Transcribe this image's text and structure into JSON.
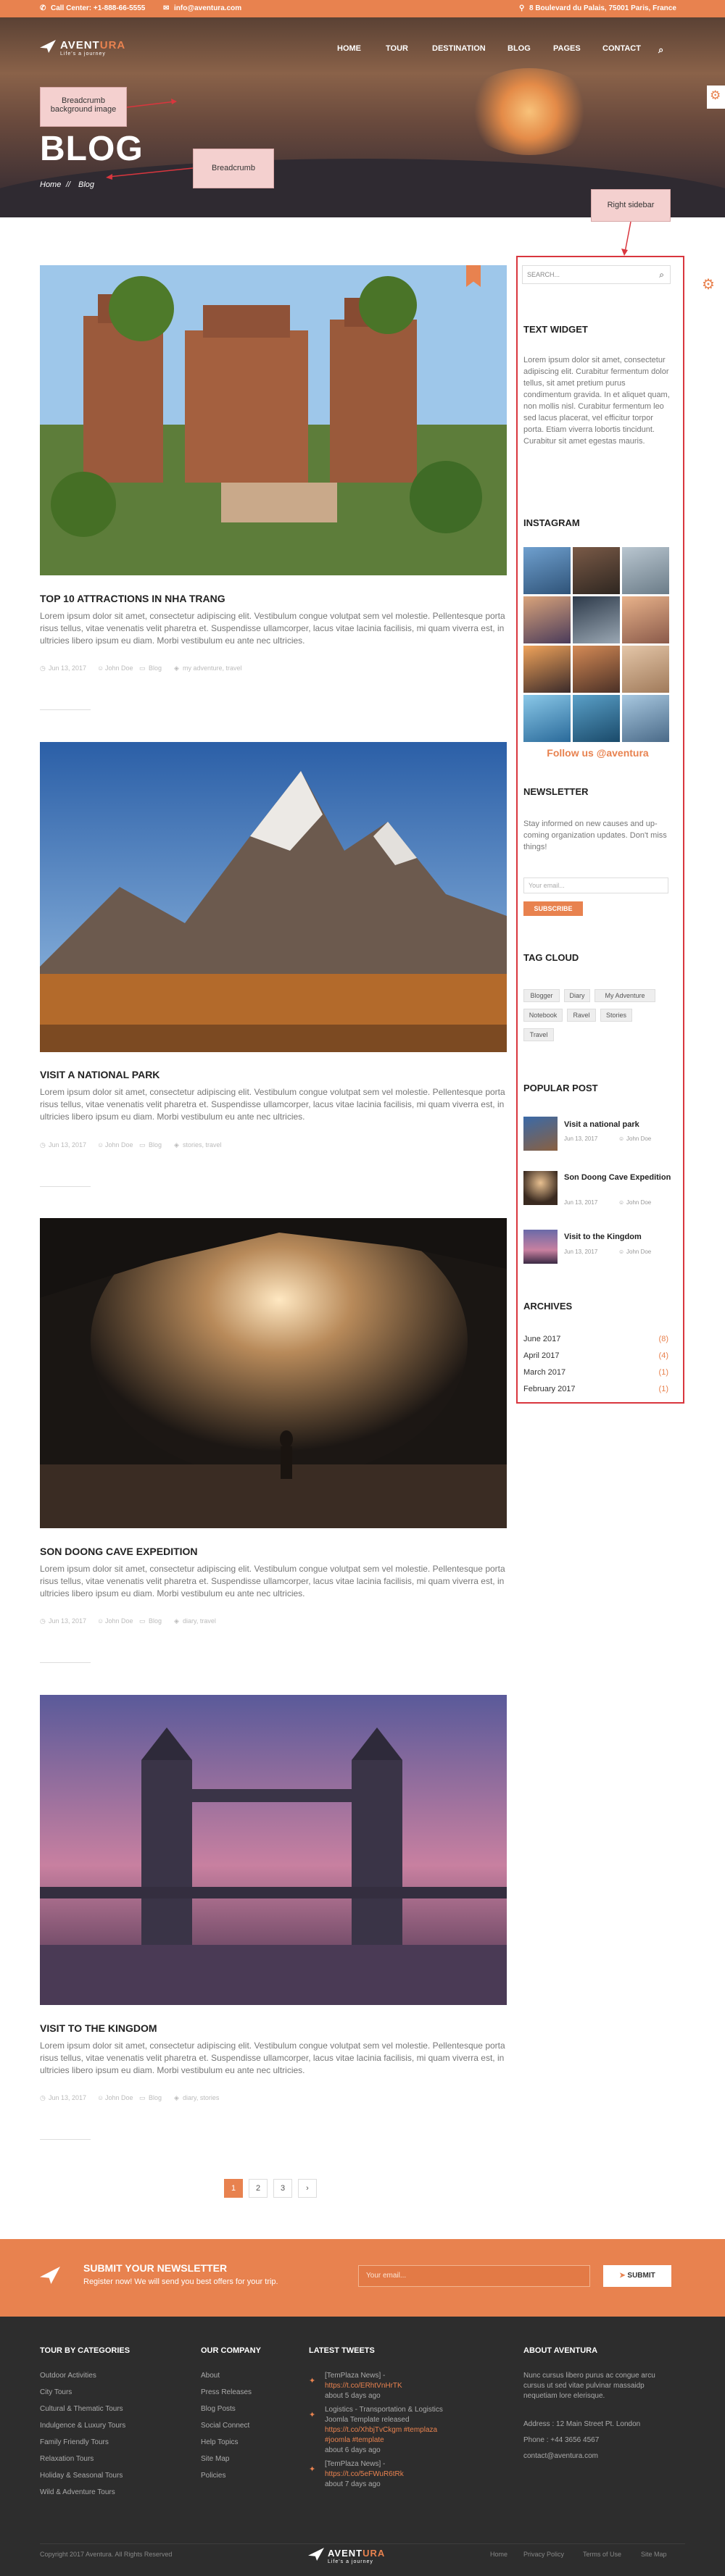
{
  "topbar": {
    "call": "Call Center: +1-888-66-5555",
    "email": "info@aventura.com",
    "address": "8 Boulevard du Palais, 75001 Paris, France"
  },
  "brand": {
    "name_main": "AVENT",
    "name_accent": "URA",
    "tagline": "Life's a journey"
  },
  "nav": {
    "items": [
      "HOME",
      "TOUR",
      "DESTINATION",
      "BLOG",
      "PAGES",
      "CONTACT"
    ]
  },
  "annotations": {
    "breadcrumb_bg": "Breadcrumb background image",
    "breadcrumb": "Breadcrumb",
    "sidebar": "Right sidebar"
  },
  "hero": {
    "title": "BLOG",
    "crumb_home": "Home",
    "crumb_sep": "//",
    "crumb_current": "Blog"
  },
  "posts": [
    {
      "title": "TOP 10 ATTRACTIONS IN NHA TRANG",
      "excerpt": "Lorem ipsum dolor sit amet, consectetur adipiscing elit. Vestibulum congue volutpat sem vel molestie. Pellentesque porta risus tellus, vitae venenatis velit pharetra et. Suspendisse ullamcorper, lacus vitae lacinia facilisis, mi quam viverra est, in ultricies libero ipsum eu diam. Morbi vestibulum eu ante nec ultricies.",
      "date": "Jun 13, 2017",
      "author": "John Doe",
      "category": "Blog",
      "tags": "my adventure, travel"
    },
    {
      "title": "VISIT A NATIONAL PARK",
      "excerpt": "Lorem ipsum dolor sit amet, consectetur adipiscing elit. Vestibulum congue volutpat sem vel molestie. Pellentesque porta risus tellus, vitae venenatis velit pharetra et. Suspendisse ullamcorper, lacus vitae lacinia facilisis, mi quam viverra est, in ultricies libero ipsum eu diam. Morbi vestibulum eu ante nec ultricies.",
      "date": "Jun 13, 2017",
      "author": "John Doe",
      "category": "Blog",
      "tags": "stories, travel"
    },
    {
      "title": "SON DOONG CAVE EXPEDITION",
      "excerpt": "Lorem ipsum dolor sit amet, consectetur adipiscing elit. Vestibulum congue volutpat sem vel molestie. Pellentesque porta risus tellus, vitae venenatis velit pharetra et. Suspendisse ullamcorper, lacus vitae lacinia facilisis, mi quam viverra est, in ultricies libero ipsum eu diam. Morbi vestibulum eu ante nec ultricies.",
      "date": "Jun 13, 2017",
      "author": "John Doe",
      "category": "Blog",
      "tags": "diary, travel"
    },
    {
      "title": "VISIT TO THE KINGDOM",
      "excerpt": "Lorem ipsum dolor sit amet, consectetur adipiscing elit. Vestibulum congue volutpat sem vel molestie. Pellentesque porta risus tellus, vitae venenatis velit pharetra et. Suspendisse ullamcorper, lacus vitae lacinia facilisis, mi quam viverra est, in ultricies libero ipsum eu diam. Morbi vestibulum eu ante nec ultricies.",
      "date": "Jun 13, 2017",
      "author": "John Doe",
      "category": "Blog",
      "tags": "diary, stories"
    }
  ],
  "sidebar": {
    "search_placeholder": "SEARCH...",
    "text_widget_title": "TEXT WIDGET",
    "text_widget_body": "Lorem ipsum dolor sit amet, consectetur adipiscing elit. Curabitur fermentum dolor tellus, sit amet pretium purus condimentum gravida. In et aliquet quam, non mollis nisl. Curabitur fermentum leo sed lacus placerat, vel efficitur torpor porta. Etiam viverra lobortis tincidunt. Curabitur sit amet egestas mauris.",
    "instagram_title": "INSTAGRAM",
    "instagram_follow": "Follow us @aventura",
    "newsletter_title": "NEWSLETTER",
    "newsletter_body": "Stay informed on new causes and up-coming organization updates. Don't miss things!",
    "newsletter_placeholder": "Your email...",
    "newsletter_button": "SUBSCRIBE",
    "tagcloud_title": "TAG CLOUD",
    "tags": [
      "Blogger",
      "Diary",
      "My Adventure",
      "Notebook",
      "Ravel",
      "Stories",
      "Travel"
    ],
    "popular_title": "POPULAR POST",
    "popular": [
      {
        "title": "Visit a national park",
        "date": "Jun 13, 2017",
        "author": "John Doe"
      },
      {
        "title": "Son Doong Cave Expedition",
        "date": "Jun 13, 2017",
        "author": "John Doe"
      },
      {
        "title": "Visit to the Kingdom",
        "date": "Jun 13, 2017",
        "author": "John Doe"
      }
    ],
    "archives_title": "ARCHIVES",
    "archives": [
      {
        "label": "June 2017",
        "count": "(8)"
      },
      {
        "label": "April 2017",
        "count": "(4)"
      },
      {
        "label": "March 2017",
        "count": "(1)"
      },
      {
        "label": "February 2017",
        "count": "(1)"
      }
    ]
  },
  "pagination": {
    "pages": [
      "1",
      "2",
      "3",
      "›"
    ],
    "current": "1"
  },
  "newsletter_bar": {
    "title": "SUBMIT YOUR NEWSLETTER",
    "subtitle": "Register now! We will send you best offers for your trip.",
    "placeholder": "Your email...",
    "button": "SUBMIT"
  },
  "footer": {
    "col1_title": "TOUR BY CATEGORIES",
    "col1_links": [
      "Outdoor Activities",
      "City Tours",
      "Cultural & Thematic Tours",
      "Indulgence & Luxury Tours",
      "Family Friendly Tours",
      "Relaxation Tours",
      "Holiday & Seasonal Tours",
      "Wild & Adventure Tours"
    ],
    "col2_title": "OUR COMPANY",
    "col2_links": [
      "About",
      "Press Releases",
      "Blog Posts",
      "Social Connect",
      "Help Topics",
      "Site Map",
      "Policies"
    ],
    "col3_title": "LATEST TWEETS",
    "tweets": [
      {
        "pre": "[TemPlaza News] - ",
        "link": "https://t.co/ERhtVnHrTK",
        "post": "",
        "time": "about 5 days ago"
      },
      {
        "pre": "Logistics - Transportation & Logistics Joomla Template released ",
        "link": "https://t.co/XhbjTvCkgm #templaza #joomla #template",
        "post": "",
        "time": "about 6 days ago"
      },
      {
        "pre": "[TemPlaza News] - ",
        "link": "https://t.co/5eFWuR6tRk",
        "post": "",
        "time": "about 7 days ago"
      }
    ],
    "col4_title": "ABOUT AVENTURA",
    "about_text": "Nunc cursus libero purus ac congue arcu cursus ut sed vitae pulvinar massaidp nequetiam lore elerisque.",
    "address": "Address : 12 Main Street Pt. London",
    "phone": "Phone : +44 3656 4567",
    "email": "contact@aventura.com",
    "copyright": "Copyright 2017 Aventura. All Rights Reserved",
    "bottom_links": [
      "Home",
      "Privacy Policy",
      "Terms of Use",
      "Site Map"
    ]
  },
  "colors": {
    "accent": "#e8824f",
    "footer_bg": "#2d2d2d",
    "annotation_border": "#d9363e",
    "callout_bg": "#f4d0cf"
  }
}
